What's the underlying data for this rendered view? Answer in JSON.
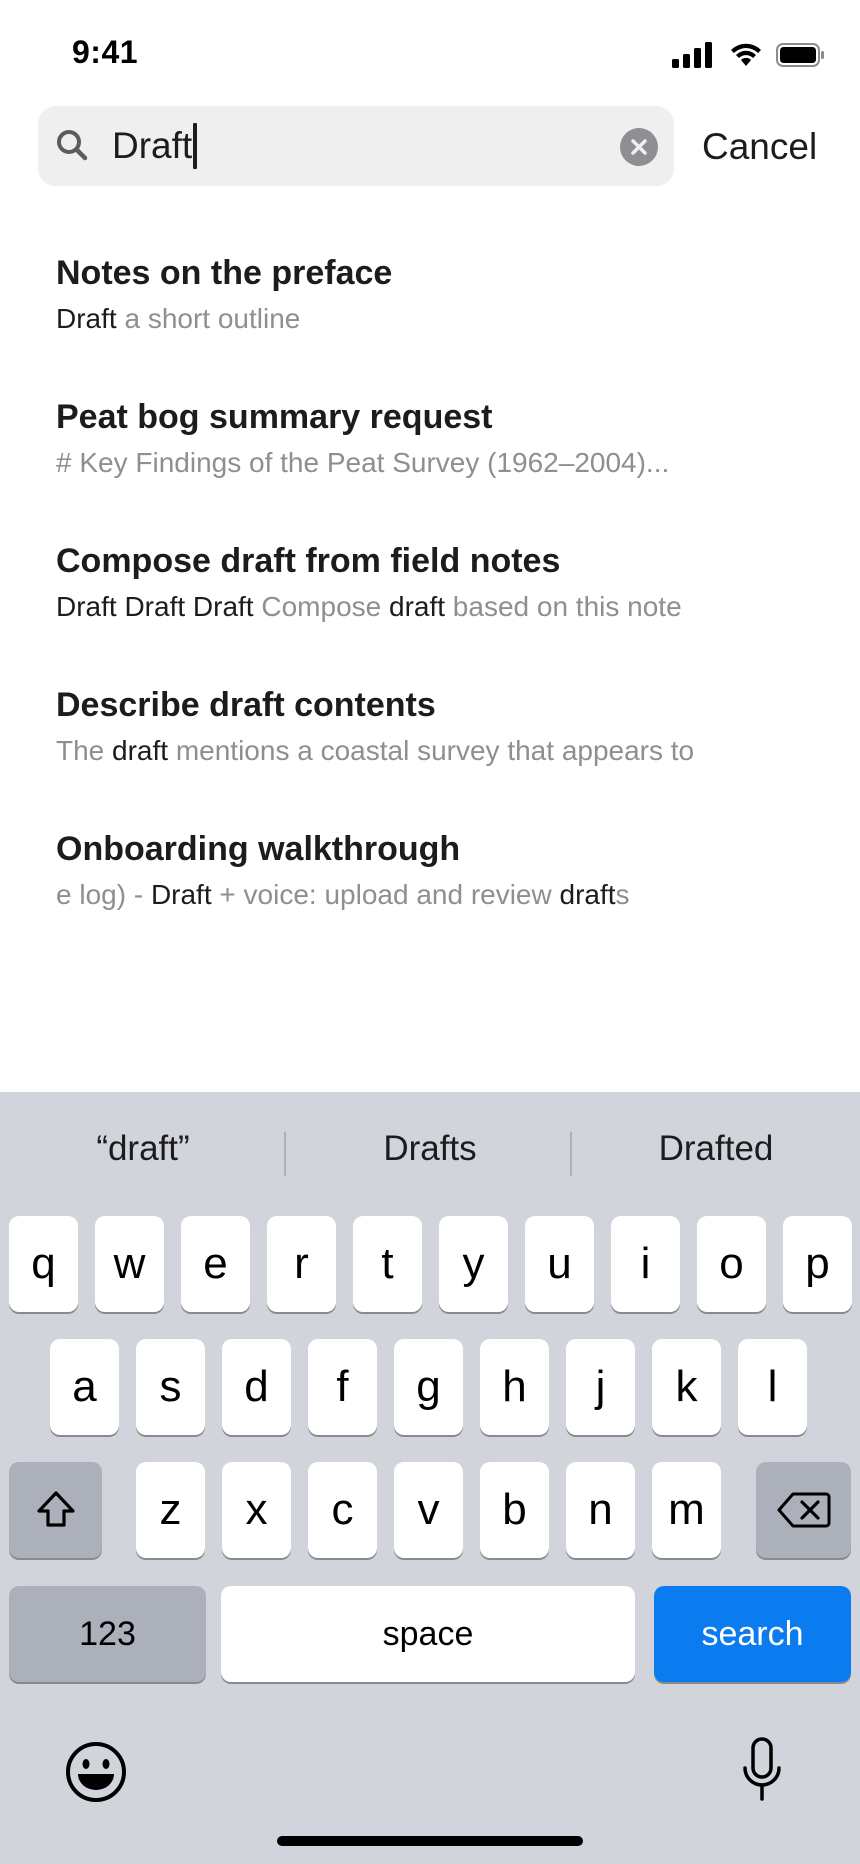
{
  "status_bar": {
    "time": "9:41"
  },
  "search": {
    "query": "Draft",
    "cancel_label": "Cancel"
  },
  "results": [
    {
      "title": [
        {
          "t": "Notes on the preface",
          "h": true
        }
      ],
      "snippet": [
        {
          "t": "Draft",
          "h": true
        },
        {
          "t": " a short outline",
          "h": false
        }
      ]
    },
    {
      "title": [
        {
          "t": "Peat bog summary request",
          "h": true
        }
      ],
      "snippet": [
        {
          "t": "# Key Findings of the Peat Survey (1962–2004)...",
          "h": false
        }
      ]
    },
    {
      "title": [
        {
          "t": "Compose draft from field notes",
          "h": true
        }
      ],
      "snippet": [
        {
          "t": "Draft Draft Draft",
          "h": true
        },
        {
          "t": " Compose ",
          "h": false
        },
        {
          "t": "draft",
          "h": true
        },
        {
          "t": " based on this note",
          "h": false
        }
      ]
    },
    {
      "title": [
        {
          "t": "Describe draft contents",
          "h": true
        }
      ],
      "snippet": [
        {
          "t": "The ",
          "h": false
        },
        {
          "t": "draft",
          "h": true
        },
        {
          "t": " mentions a coastal survey that appears to",
          "h": false
        }
      ]
    },
    {
      "title": [
        {
          "t": "Onboarding walkthrough",
          "h": true
        }
      ],
      "snippet": [
        {
          "t": "e log) - ",
          "h": false
        },
        {
          "t": "Draft",
          "h": true
        },
        {
          "t": " + voice: upload and review ",
          "h": false
        },
        {
          "t": "draft",
          "h": true
        },
        {
          "t": "s",
          "h": false
        }
      ]
    }
  ],
  "keyboard": {
    "suggestions": [
      "“draft”",
      "Drafts",
      "Drafted"
    ],
    "row1": [
      "q",
      "w",
      "e",
      "r",
      "t",
      "y",
      "u",
      "i",
      "o",
      "p"
    ],
    "row2": [
      "a",
      "s",
      "d",
      "f",
      "g",
      "h",
      "j",
      "k",
      "l"
    ],
    "row3": [
      "z",
      "x",
      "c",
      "v",
      "b",
      "n",
      "m"
    ],
    "numbers_label": "123",
    "space_label": "space",
    "search_label": "search",
    "icons": {
      "shift": "shift-icon",
      "delete": "delete-icon",
      "emoji": "emoji-icon",
      "mic": "microphone-icon"
    },
    "colors": {
      "background": "#d2d4db",
      "key": "#ffffff",
      "dark_key": "#abb0bb",
      "accent": "#0b7bf0"
    }
  }
}
